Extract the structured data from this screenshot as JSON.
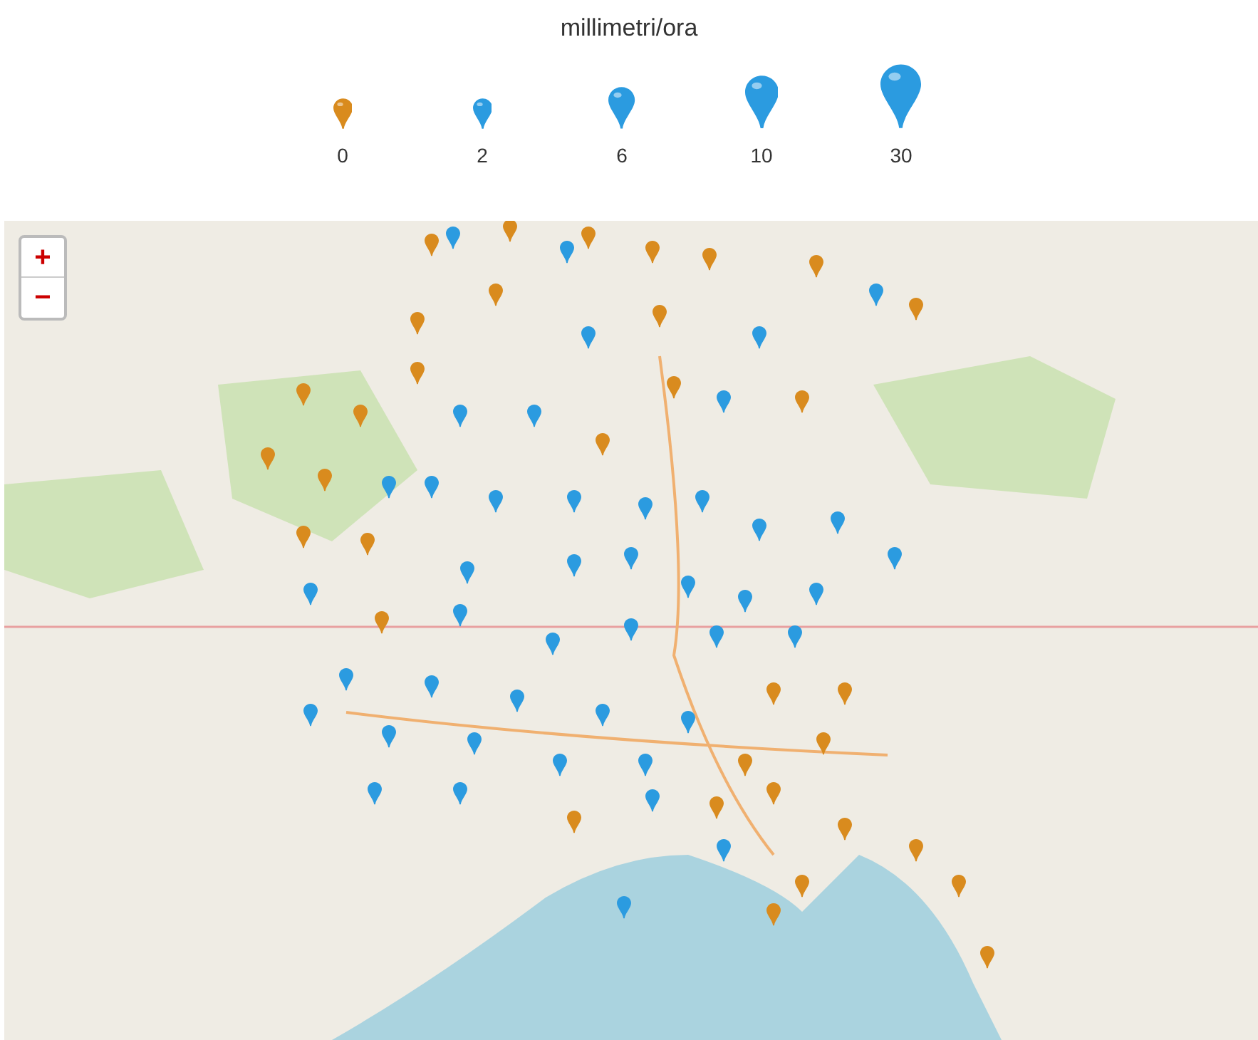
{
  "legend": {
    "title": "millimetri/ora",
    "items": [
      {
        "label": "0",
        "color": "#d98b1e",
        "kind": "small"
      },
      {
        "label": "2",
        "color": "#2b9be0",
        "kind": "small"
      },
      {
        "label": "6",
        "color": "#2b9be0",
        "kind": "medium"
      },
      {
        "label": "10",
        "color": "#2b9be0",
        "kind": "large"
      },
      {
        "label": "30",
        "color": "#2b9be0",
        "kind": "xlarge"
      }
    ]
  },
  "map": {
    "zoom_in": "+",
    "zoom_out": "−"
  }
}
